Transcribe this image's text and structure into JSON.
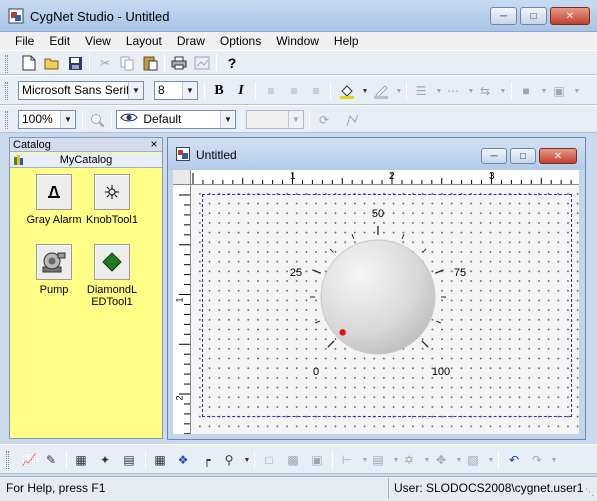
{
  "window": {
    "title": "CygNet Studio - Untitled"
  },
  "menu": [
    "File",
    "Edit",
    "View",
    "Layout",
    "Draw",
    "Options",
    "Window",
    "Help"
  ],
  "format_bar": {
    "font_name": "Microsoft Sans Serif",
    "font_size": "8"
  },
  "view_bar": {
    "zoom": "100%",
    "layer": "Default",
    "extra": ""
  },
  "catalog": {
    "title": "Catalog",
    "library": "MyCatalog",
    "items": [
      {
        "label": "Gray Alarm",
        "icon": "gray-alarm-icon"
      },
      {
        "label": "KnobTool1",
        "icon": "knob-tool-icon"
      },
      {
        "label": "Pump",
        "icon": "pump-icon"
      },
      {
        "label": "DiamondLEDTool1",
        "label_line1": "DiamondL",
        "label_line2": "EDTool1",
        "icon": "diamond-led-icon"
      }
    ]
  },
  "document": {
    "title": "Untitled",
    "ruler_h_labels": [
      "1",
      "2",
      "3"
    ],
    "ruler_v_labels": [
      "1",
      "2"
    ],
    "knob": {
      "scale_labels": {
        "min": "0",
        "q1": "25",
        "mid": "50",
        "q3": "75",
        "max": "100"
      },
      "value": 0,
      "min": 0,
      "max": 100,
      "indicator_color": "#e01010"
    }
  },
  "status": {
    "help": "For Help, press F1",
    "user": "User: SLODOCS2008\\cygnet.user1"
  },
  "colors": {
    "catalog_bg": "#ffff88",
    "accent": "#2a2ad8"
  }
}
